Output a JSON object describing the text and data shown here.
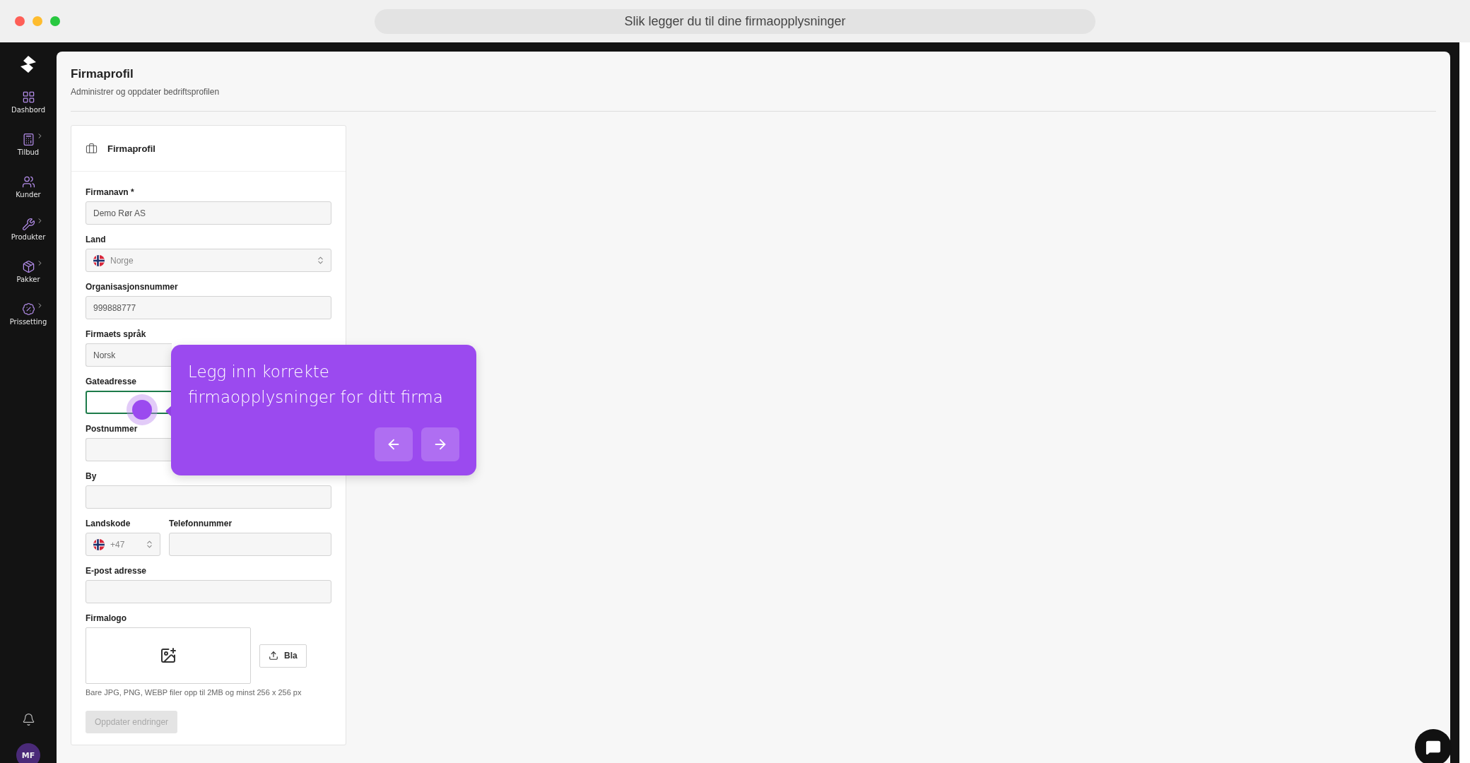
{
  "window": {
    "title": "Slik legger du til dine firmaopplysninger"
  },
  "sidebar": {
    "items": [
      {
        "label": "Dashbord",
        "expandable": false
      },
      {
        "label": "Tilbud",
        "expandable": true
      },
      {
        "label": "Kunder",
        "expandable": false
      },
      {
        "label": "Produkter",
        "expandable": true
      },
      {
        "label": "Pakker",
        "expandable": true
      },
      {
        "label": "Prissetting",
        "expandable": true
      }
    ],
    "avatar": "MF"
  },
  "page": {
    "title": "Firmaprofil",
    "subtitle": "Administrer og oppdater bedriftsprofilen"
  },
  "card": {
    "title": "Firmaprofil",
    "fields": [
      {
        "kind": "input",
        "label": "Firmanavn *",
        "value": "Demo Rør AS",
        "focused": false
      },
      {
        "kind": "country",
        "label": "Land",
        "value": "Norge"
      },
      {
        "kind": "input",
        "label": "Organisasjonsnummer",
        "value": "999888777",
        "focused": false
      },
      {
        "kind": "input",
        "label": "Firmaets språk",
        "value": "Norsk",
        "focused": false
      },
      {
        "kind": "input",
        "label": "Gateadresse",
        "focused": true
      },
      {
        "kind": "input",
        "label": "Postnummer",
        "focused": false
      },
      {
        "kind": "input",
        "label": "By",
        "focused": false
      },
      {
        "kind": "phone",
        "label": "Landskode",
        "value": "+47",
        "phone_label": "Telefonnummer"
      },
      {
        "kind": "input",
        "label": "E-post adresse",
        "focused": false
      },
      {
        "kind": "upload",
        "label": "Firmalogo",
        "button": "Bla",
        "hint": "Bare JPG, PNG, WEBP filer opp til 2MB og minst 256 x 256 px"
      }
    ],
    "submit": {
      "label": "Oppdater endringer",
      "disabled": true
    }
  },
  "tooltip": {
    "text": "Legg inn korrekte firmaopplysninger for ditt firma"
  }
}
